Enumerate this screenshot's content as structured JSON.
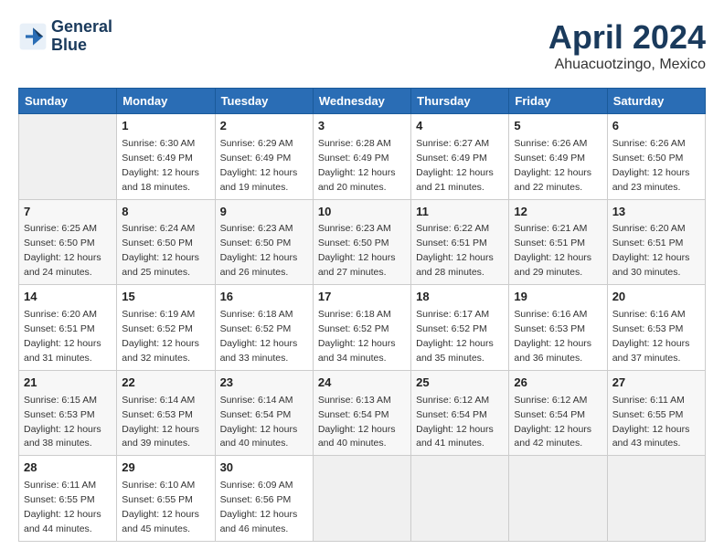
{
  "header": {
    "logo_line1": "General",
    "logo_line2": "Blue",
    "month": "April 2024",
    "location": "Ahuacuotzingo, Mexico"
  },
  "weekdays": [
    "Sunday",
    "Monday",
    "Tuesday",
    "Wednesday",
    "Thursday",
    "Friday",
    "Saturday"
  ],
  "weeks": [
    [
      {
        "day": null,
        "sunrise": null,
        "sunset": null,
        "daylight": null
      },
      {
        "day": "1",
        "sunrise": "Sunrise: 6:30 AM",
        "sunset": "Sunset: 6:49 PM",
        "daylight": "Daylight: 12 hours and 18 minutes."
      },
      {
        "day": "2",
        "sunrise": "Sunrise: 6:29 AM",
        "sunset": "Sunset: 6:49 PM",
        "daylight": "Daylight: 12 hours and 19 minutes."
      },
      {
        "day": "3",
        "sunrise": "Sunrise: 6:28 AM",
        "sunset": "Sunset: 6:49 PM",
        "daylight": "Daylight: 12 hours and 20 minutes."
      },
      {
        "day": "4",
        "sunrise": "Sunrise: 6:27 AM",
        "sunset": "Sunset: 6:49 PM",
        "daylight": "Daylight: 12 hours and 21 minutes."
      },
      {
        "day": "5",
        "sunrise": "Sunrise: 6:26 AM",
        "sunset": "Sunset: 6:49 PM",
        "daylight": "Daylight: 12 hours and 22 minutes."
      },
      {
        "day": "6",
        "sunrise": "Sunrise: 6:26 AM",
        "sunset": "Sunset: 6:50 PM",
        "daylight": "Daylight: 12 hours and 23 minutes."
      }
    ],
    [
      {
        "day": "7",
        "sunrise": "Sunrise: 6:25 AM",
        "sunset": "Sunset: 6:50 PM",
        "daylight": "Daylight: 12 hours and 24 minutes."
      },
      {
        "day": "8",
        "sunrise": "Sunrise: 6:24 AM",
        "sunset": "Sunset: 6:50 PM",
        "daylight": "Daylight: 12 hours and 25 minutes."
      },
      {
        "day": "9",
        "sunrise": "Sunrise: 6:23 AM",
        "sunset": "Sunset: 6:50 PM",
        "daylight": "Daylight: 12 hours and 26 minutes."
      },
      {
        "day": "10",
        "sunrise": "Sunrise: 6:23 AM",
        "sunset": "Sunset: 6:50 PM",
        "daylight": "Daylight: 12 hours and 27 minutes."
      },
      {
        "day": "11",
        "sunrise": "Sunrise: 6:22 AM",
        "sunset": "Sunset: 6:51 PM",
        "daylight": "Daylight: 12 hours and 28 minutes."
      },
      {
        "day": "12",
        "sunrise": "Sunrise: 6:21 AM",
        "sunset": "Sunset: 6:51 PM",
        "daylight": "Daylight: 12 hours and 29 minutes."
      },
      {
        "day": "13",
        "sunrise": "Sunrise: 6:20 AM",
        "sunset": "Sunset: 6:51 PM",
        "daylight": "Daylight: 12 hours and 30 minutes."
      }
    ],
    [
      {
        "day": "14",
        "sunrise": "Sunrise: 6:20 AM",
        "sunset": "Sunset: 6:51 PM",
        "daylight": "Daylight: 12 hours and 31 minutes."
      },
      {
        "day": "15",
        "sunrise": "Sunrise: 6:19 AM",
        "sunset": "Sunset: 6:52 PM",
        "daylight": "Daylight: 12 hours and 32 minutes."
      },
      {
        "day": "16",
        "sunrise": "Sunrise: 6:18 AM",
        "sunset": "Sunset: 6:52 PM",
        "daylight": "Daylight: 12 hours and 33 minutes."
      },
      {
        "day": "17",
        "sunrise": "Sunrise: 6:18 AM",
        "sunset": "Sunset: 6:52 PM",
        "daylight": "Daylight: 12 hours and 34 minutes."
      },
      {
        "day": "18",
        "sunrise": "Sunrise: 6:17 AM",
        "sunset": "Sunset: 6:52 PM",
        "daylight": "Daylight: 12 hours and 35 minutes."
      },
      {
        "day": "19",
        "sunrise": "Sunrise: 6:16 AM",
        "sunset": "Sunset: 6:53 PM",
        "daylight": "Daylight: 12 hours and 36 minutes."
      },
      {
        "day": "20",
        "sunrise": "Sunrise: 6:16 AM",
        "sunset": "Sunset: 6:53 PM",
        "daylight": "Daylight: 12 hours and 37 minutes."
      }
    ],
    [
      {
        "day": "21",
        "sunrise": "Sunrise: 6:15 AM",
        "sunset": "Sunset: 6:53 PM",
        "daylight": "Daylight: 12 hours and 38 minutes."
      },
      {
        "day": "22",
        "sunrise": "Sunrise: 6:14 AM",
        "sunset": "Sunset: 6:53 PM",
        "daylight": "Daylight: 12 hours and 39 minutes."
      },
      {
        "day": "23",
        "sunrise": "Sunrise: 6:14 AM",
        "sunset": "Sunset: 6:54 PM",
        "daylight": "Daylight: 12 hours and 40 minutes."
      },
      {
        "day": "24",
        "sunrise": "Sunrise: 6:13 AM",
        "sunset": "Sunset: 6:54 PM",
        "daylight": "Daylight: 12 hours and 40 minutes."
      },
      {
        "day": "25",
        "sunrise": "Sunrise: 6:12 AM",
        "sunset": "Sunset: 6:54 PM",
        "daylight": "Daylight: 12 hours and 41 minutes."
      },
      {
        "day": "26",
        "sunrise": "Sunrise: 6:12 AM",
        "sunset": "Sunset: 6:54 PM",
        "daylight": "Daylight: 12 hours and 42 minutes."
      },
      {
        "day": "27",
        "sunrise": "Sunrise: 6:11 AM",
        "sunset": "Sunset: 6:55 PM",
        "daylight": "Daylight: 12 hours and 43 minutes."
      }
    ],
    [
      {
        "day": "28",
        "sunrise": "Sunrise: 6:11 AM",
        "sunset": "Sunset: 6:55 PM",
        "daylight": "Daylight: 12 hours and 44 minutes."
      },
      {
        "day": "29",
        "sunrise": "Sunrise: 6:10 AM",
        "sunset": "Sunset: 6:55 PM",
        "daylight": "Daylight: 12 hours and 45 minutes."
      },
      {
        "day": "30",
        "sunrise": "Sunrise: 6:09 AM",
        "sunset": "Sunset: 6:56 PM",
        "daylight": "Daylight: 12 hours and 46 minutes."
      },
      {
        "day": null,
        "sunrise": null,
        "sunset": null,
        "daylight": null
      },
      {
        "day": null,
        "sunrise": null,
        "sunset": null,
        "daylight": null
      },
      {
        "day": null,
        "sunrise": null,
        "sunset": null,
        "daylight": null
      },
      {
        "day": null,
        "sunrise": null,
        "sunset": null,
        "daylight": null
      }
    ]
  ]
}
